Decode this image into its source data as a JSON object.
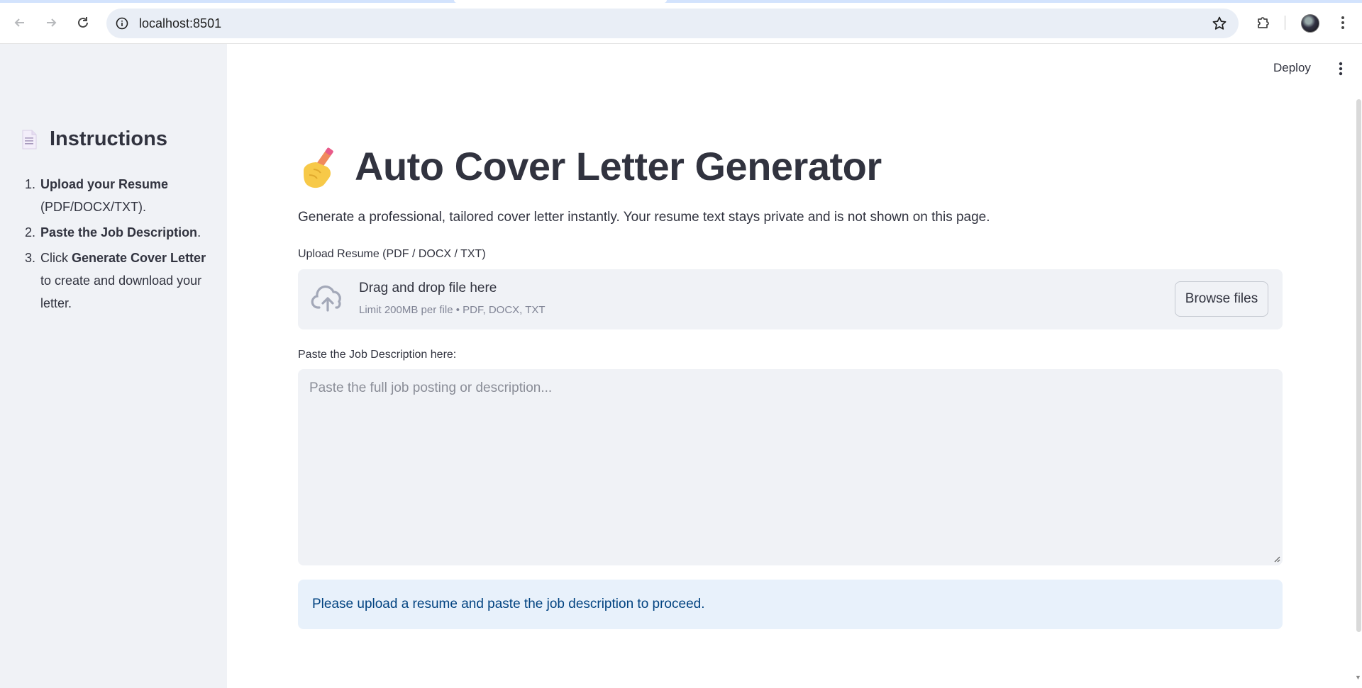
{
  "browser": {
    "url": "localhost:8501"
  },
  "sidebar": {
    "heading": "Instructions",
    "steps": [
      {
        "bold": "Upload your Resume",
        "rest": " (PDF/DOCX/TXT)."
      },
      {
        "bold": "Paste the Job Description",
        "rest": "."
      },
      {
        "pre": "Click ",
        "bold": "Generate Cover Letter",
        "rest": " to create and download your letter."
      }
    ]
  },
  "header": {
    "deploy_label": "Deploy"
  },
  "main": {
    "title": "Auto Cover Letter Generator",
    "subtitle": "Generate a professional, tailored cover letter instantly. Your resume text stays private and is not shown on this page.",
    "upload": {
      "label": "Upload Resume (PDF / DOCX / TXT)",
      "drop_text": "Drag and drop file here",
      "limit_text": "Limit 200MB per file • PDF, DOCX, TXT",
      "browse_label": "Browse files"
    },
    "job_description": {
      "label": "Paste the Job Description here:",
      "value": "",
      "placeholder": "Paste the full job posting or description..."
    },
    "info_message": "Please upload a resume and paste the job description to proceed."
  },
  "icons": {
    "back": "arrow-left-icon",
    "forward": "arrow-right-icon",
    "reload": "reload-icon",
    "info": "info-icon",
    "bookmark": "star-icon",
    "extensions": "puzzle-icon",
    "chrome_menu": "vertical-dots-icon",
    "doc": "document-icon",
    "title_emoji": "writing-hand-icon",
    "upload": "cloud-upload-icon",
    "app_menu": "kebab-icon"
  },
  "colors": {
    "sidebar_bg": "#f0f2f6",
    "text": "#31333f",
    "info_bg": "#e8f1fb",
    "info_text": "#004280",
    "omnibox_bg": "#e9eef6"
  }
}
